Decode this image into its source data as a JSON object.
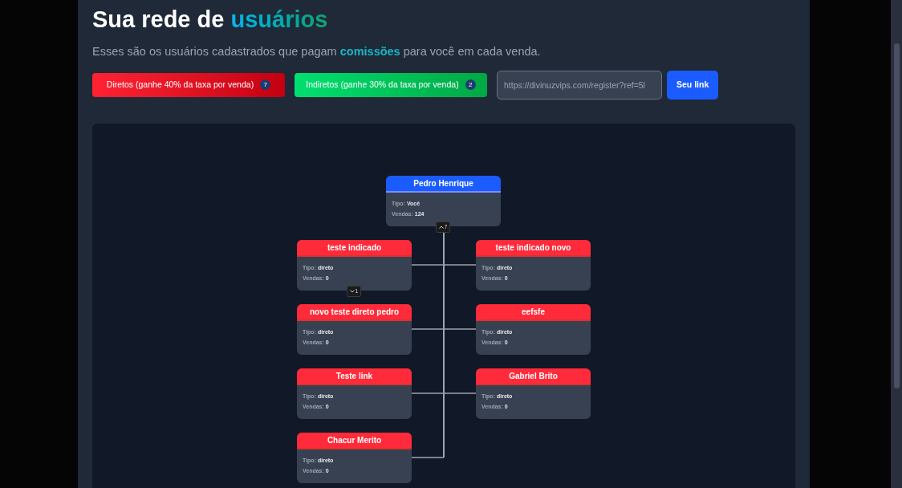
{
  "header": {
    "title": "Sua rede de",
    "title_highlight": "usuários",
    "subtitle_before": "Esses são os usuários cadastrados que pagam",
    "subtitle_highlight": "comissões",
    "subtitle_after": "para você em cada venda."
  },
  "filters": [
    {
      "label": "Diretos (ganhe 40% da taxa por venda)",
      "count": "7",
      "kind": "direct"
    },
    {
      "label": "Indiretos (ganhe 30% da taxa por venda)",
      "count": "2",
      "kind": "indirect"
    }
  ],
  "referral": {
    "value": "https://divinuzvips.com/register?ref=5l",
    "button": "Seu link"
  },
  "tree": {
    "root": {
      "name": "Pedro Henrique",
      "kind": "self",
      "type_label": "Tipo:",
      "type": "Você",
      "sales_label": "Vendas:",
      "sales": "124",
      "toggle": {
        "count": "7",
        "expanded": true
      }
    },
    "children": [
      {
        "name": "teste indicado",
        "kind": "direct",
        "type_label": "Tipo:",
        "type": "direto",
        "sales_label": "Vendas:",
        "sales": "0",
        "toggle": {
          "count": "1",
          "expanded": false
        }
      },
      {
        "name": "teste indicado novo",
        "kind": "direct",
        "type_label": "Tipo:",
        "type": "direto",
        "sales_label": "Vendas:",
        "sales": "0"
      },
      {
        "name": "novo teste direto pedro",
        "kind": "direct",
        "type_label": "Tipo:",
        "type": "direto",
        "sales_label": "Vendas:",
        "sales": "0"
      },
      {
        "name": "eefsfe",
        "kind": "direct",
        "type_label": "Tipo:",
        "type": "direto",
        "sales_label": "Vendas:",
        "sales": "0"
      },
      {
        "name": "Teste link",
        "kind": "direct",
        "type_label": "Tipo:",
        "type": "direto",
        "sales_label": "Vendas:",
        "sales": "0"
      },
      {
        "name": "Gabriel Brito",
        "kind": "direct",
        "type_label": "Tipo:",
        "type": "direto",
        "sales_label": "Vendas:",
        "sales": "0"
      },
      {
        "name": "Chacur Merito",
        "kind": "direct",
        "type_label": "Tipo:",
        "type": "direto",
        "sales_label": "Vendas:",
        "sales": "0"
      }
    ]
  }
}
